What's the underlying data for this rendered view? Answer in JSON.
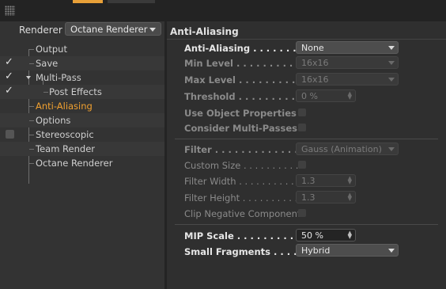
{
  "renderer": {
    "label": "Renderer",
    "selected": "Octane Renderer"
  },
  "tree": [
    {
      "label": "Output",
      "checked": false,
      "has_checkbox": false
    },
    {
      "label": "Save",
      "checked": true,
      "has_checkbox": true
    },
    {
      "label": "Multi-Pass",
      "checked": true,
      "has_checkbox": true
    },
    {
      "label": "Post Effects",
      "checked": true,
      "has_checkbox": true
    },
    {
      "label": "Anti-Aliasing",
      "checked": false,
      "has_checkbox": false,
      "active": true
    },
    {
      "label": "Options",
      "checked": false,
      "has_checkbox": false
    },
    {
      "label": "Stereoscopic",
      "checked": false,
      "has_checkbox": true
    },
    {
      "label": "Team Render",
      "checked": false,
      "has_checkbox": false
    },
    {
      "label": "Octane Renderer",
      "checked": false,
      "has_checkbox": false
    }
  ],
  "section": {
    "title": "Anti-Aliasing"
  },
  "props": {
    "anti_aliasing": {
      "label": "Anti-Aliasing",
      "value": "None"
    },
    "min_level": {
      "label": "Min Level",
      "value": "16x16"
    },
    "max_level": {
      "label": "Max Level",
      "value": "16x16"
    },
    "threshold": {
      "label": "Threshold",
      "value": "0 %"
    },
    "use_object_properties": {
      "label": "Use Object Properties"
    },
    "consider_multi_passes": {
      "label": "Consider Multi-Passes"
    },
    "filter": {
      "label": "Filter",
      "value": "Gauss (Animation)"
    },
    "custom_size": {
      "label": "Custom Size"
    },
    "filter_width": {
      "label": "Filter Width",
      "value": "1.3"
    },
    "filter_height": {
      "label": "Filter Height",
      "value": "1.3"
    },
    "clip_negative": {
      "label": "Clip Negative Component"
    },
    "mip_scale": {
      "label": "MIP Scale",
      "value": "50 %"
    },
    "small_fragments": {
      "label": "Small Fragments",
      "value": "Hybrid"
    }
  },
  "colors": {
    "accent": "#f0a030",
    "panel": "#333333"
  }
}
